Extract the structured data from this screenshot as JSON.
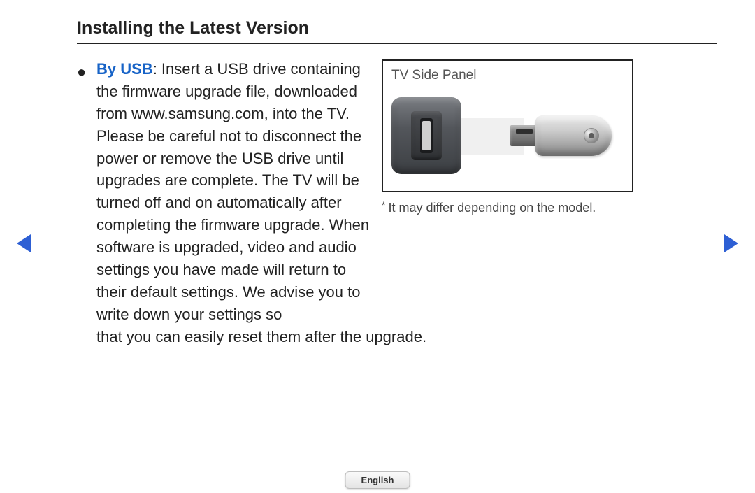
{
  "title": "Installing the Latest Version",
  "bullet": {
    "term": "By USB",
    "body_lines": ": Insert a USB drive containing the firmware upgrade file, downloaded from www.samsung.com, into the TV. Please be careful not to disconnect the power or remove the USB drive until upgrades are complete. The TV will be turned off and on automatically after completing the firmware upgrade. When software is upgraded, video and audio settings you have made will return to their default settings. We advise you to write down your settings so",
    "last_line": "that you can easily reset them after the upgrade."
  },
  "panel": {
    "label": "TV Side Panel"
  },
  "footnote": {
    "star": "*",
    "text": "It may differ depending on the model."
  },
  "language": "English"
}
